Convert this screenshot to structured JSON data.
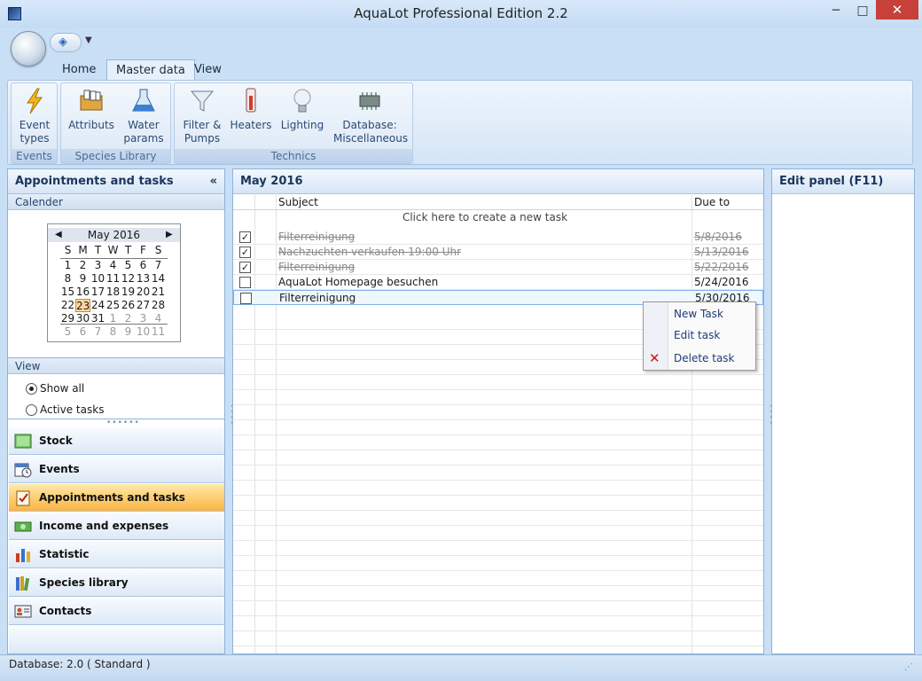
{
  "window": {
    "title": "AquaLot Professional Edition 2.2",
    "minimize": "─",
    "maximize": "□",
    "close": "✕"
  },
  "ribbon": {
    "tabs": [
      {
        "label": "Home"
      },
      {
        "label": "Master data"
      },
      {
        "label": "View"
      }
    ],
    "active_tab": "Master data",
    "groups": [
      {
        "label": "Events",
        "buttons": [
          {
            "label": "Event types",
            "icon": "lightning-icon"
          }
        ]
      },
      {
        "label": "Species Library",
        "buttons": [
          {
            "label": "Attributs",
            "icon": "card-box-icon"
          },
          {
            "label": "Water params",
            "icon": "flask-icon"
          }
        ]
      },
      {
        "label": "Technics",
        "buttons": [
          {
            "label": "Filter & Pumps",
            "icon": "funnel-icon"
          },
          {
            "label": "Heaters",
            "icon": "thermometer-icon"
          },
          {
            "label": "Lighting",
            "icon": "bulb-icon"
          },
          {
            "label": "Database: Miscellaneous",
            "icon": "chip-icon"
          }
        ]
      }
    ]
  },
  "left_panel": {
    "title": "Appointments and tasks",
    "collapse": "«",
    "calendar_label": "Calender",
    "calendar": {
      "month": "May 2016",
      "prev": "◀",
      "next": "▶",
      "weekdays": [
        "S",
        "M",
        "T",
        "W",
        "T",
        "F",
        "S"
      ],
      "weeks": [
        [
          "1",
          "2",
          "3",
          "4",
          "5",
          "6",
          "7"
        ],
        [
          "8",
          "9",
          "10",
          "11",
          "12",
          "13",
          "14"
        ],
        [
          "15",
          "16",
          "17",
          "18",
          "19",
          "20",
          "21"
        ],
        [
          "22",
          "23",
          "24",
          "25",
          "26",
          "27",
          "28"
        ],
        [
          "29",
          "30",
          "31",
          "1",
          "2",
          "3",
          "4"
        ],
        [
          "5",
          "6",
          "7",
          "8",
          "9",
          "10",
          "11"
        ]
      ],
      "today": "23"
    },
    "view_label": "View",
    "view_options": [
      {
        "label": "Show all",
        "selected": true
      },
      {
        "label": "Active tasks",
        "selected": false
      }
    ],
    "nav": [
      {
        "label": "Stock",
        "icon": "aquarium-icon",
        "active": false
      },
      {
        "label": "Events",
        "icon": "calendar-clock-icon",
        "active": false
      },
      {
        "label": "Appointments and tasks",
        "icon": "checklist-icon",
        "active": true
      },
      {
        "label": "Income and expenses",
        "icon": "money-icon",
        "active": false
      },
      {
        "label": "Statistic",
        "icon": "bar-chart-icon",
        "active": false
      },
      {
        "label": "Species library",
        "icon": "books-icon",
        "active": false
      },
      {
        "label": "Contacts",
        "icon": "contact-card-icon",
        "active": false
      }
    ]
  },
  "tasks": {
    "title": "May 2016",
    "columns": {
      "subject": "Subject",
      "due": "Due to"
    },
    "new_task_hint": "Click here to create a new task",
    "rows": [
      {
        "subject": "Filterreinigung",
        "due": "5/8/2016",
        "done": true
      },
      {
        "subject": "Nachzuchten verkaufen 19:00 Uhr",
        "due": "5/13/2016",
        "done": true
      },
      {
        "subject": "Filterreinigung",
        "due": "5/22/2016",
        "done": true
      },
      {
        "subject": "AquaLot Homepage besuchen",
        "due": "5/24/2016",
        "done": false
      },
      {
        "subject": "Filterreinigung",
        "due": "5/30/2016",
        "done": false
      }
    ],
    "check_mark": "✓"
  },
  "context_menu": {
    "items": [
      {
        "label": "New Task"
      },
      {
        "label": "Edit task"
      },
      {
        "label": "Delete task"
      }
    ],
    "delete_icon": "✕"
  },
  "right_panel": {
    "title": "Edit panel (F11)"
  },
  "status": {
    "text": "Database: 2.0 ( Standard )"
  },
  "colors": {
    "accent": "#1b355c",
    "active_nav": "#f9b545",
    "close": "#c7403a"
  }
}
